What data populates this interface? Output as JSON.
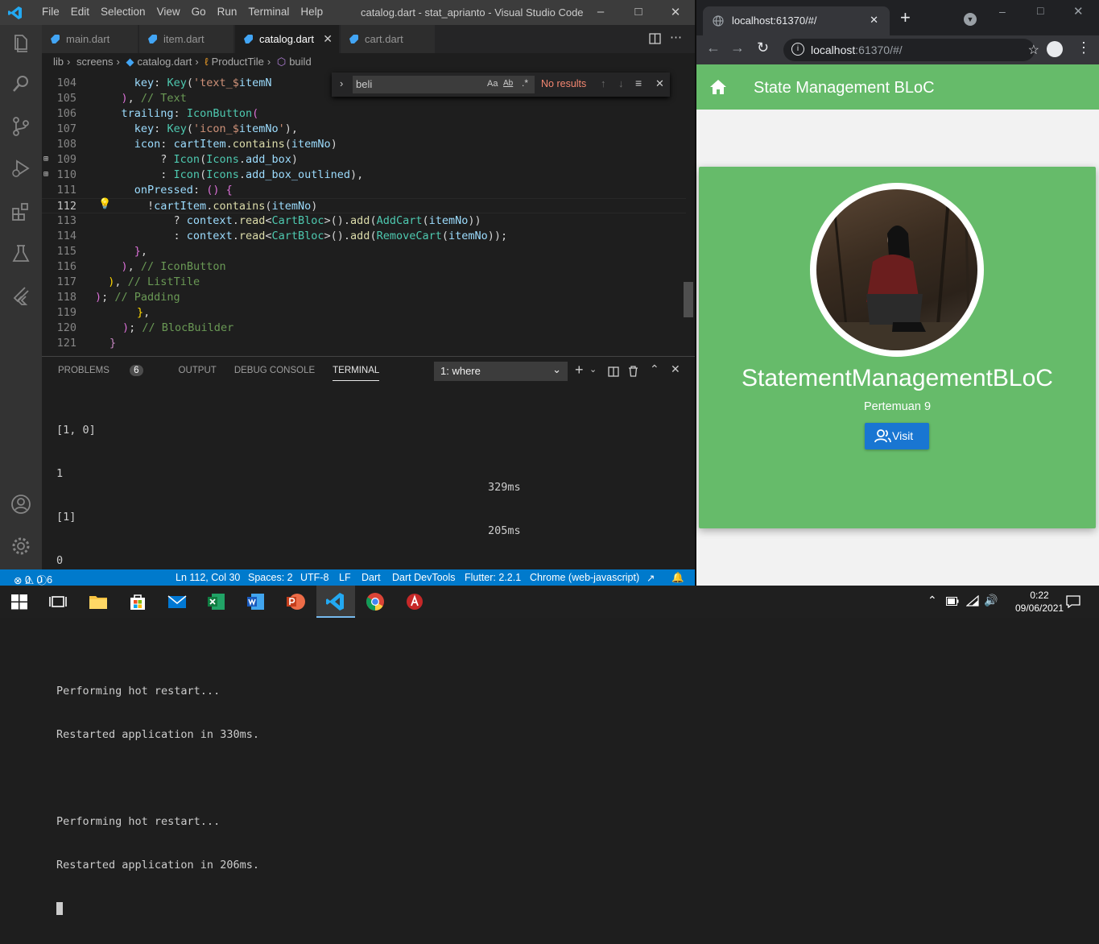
{
  "vscode": {
    "window_title": "catalog.dart - stat_aprianto - Visual Studio Code",
    "menu": [
      "File",
      "Edit",
      "Selection",
      "View",
      "Go",
      "Run",
      "Terminal",
      "Help"
    ],
    "tabs": [
      "main.dart",
      "item.dart",
      "catalog.dart",
      "cart.dart"
    ],
    "active_tab": "catalog.dart",
    "breadcrumb": [
      "lib",
      "screens",
      "catalog.dart",
      "ProductTile",
      "build"
    ],
    "find": {
      "query": "beli",
      "result": "No results"
    },
    "line_numbers": [
      "104",
      "105",
      "106",
      "107",
      "108",
      "109",
      "110",
      "111",
      "112",
      "113",
      "114",
      "115",
      "116",
      "117",
      "118",
      "119",
      "120",
      "121"
    ],
    "panel_tabs": {
      "problems": "PROBLEMS",
      "problems_count": "6",
      "output": "OUTPUT",
      "debug": "DEBUG CONSOLE",
      "terminal": "TERMINAL"
    },
    "terminal_select": "1: where",
    "terminal_lines": [
      "[1, 0]",
      "1",
      "[1]",
      "0",
      "[]",
      "",
      "Performing hot restart...",
      "Restarted application in 330ms.",
      "",
      "Performing hot restart...",
      "Restarted application in 206ms."
    ],
    "terminal_times": [
      "329ms",
      "205ms"
    ],
    "status": {
      "errors": "0",
      "warnings": "0",
      "info": "6",
      "position": "Ln 112, Col 30",
      "spaces": "Spaces: 2",
      "encoding": "UTF-8",
      "eol": "LF",
      "language": "Dart",
      "devtools": "Dart DevTools",
      "flutter": "Flutter: 2.2.1",
      "device": "Chrome (web-javascript)"
    }
  },
  "chrome": {
    "tab_title": "localhost:61370/#/",
    "url_host": "localhost",
    "url_rest": ":61370/#/",
    "app": {
      "title": "State Management BLoC",
      "card_name": "StatementManagementBLoC",
      "card_sub": "Pertemuan 9",
      "visit_label": "Visit"
    }
  },
  "taskbar": {
    "time": "0:22",
    "date": "09/06/2021"
  },
  "colors": {
    "vscode_blue": "#007acc",
    "app_green": "#66bb6a",
    "button_blue": "#1976d2"
  }
}
